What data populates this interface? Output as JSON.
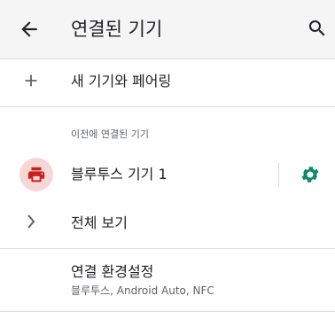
{
  "appbar": {
    "title": "연결된 기기",
    "back_icon": "arrow-back-icon",
    "search_icon": "search-icon"
  },
  "pair_new": {
    "label": "새 기기와 페어링",
    "icon": "plus-icon"
  },
  "previously_connected": {
    "header": "이전에 연결된 기기",
    "device": {
      "name": "블루투스 기기 1",
      "icon": "printer-icon",
      "settings_icon": "gear-icon"
    }
  },
  "see_all": {
    "label": "전체 보기",
    "icon": "chevron-right-icon"
  },
  "preferences": {
    "label": "연결 환경설정",
    "summary": "블루투스, Android Auto, NFC"
  },
  "colors": {
    "accent": "#0f8a6d",
    "device_icon": "#c5221f",
    "device_bubble": "#f7d6d6"
  }
}
